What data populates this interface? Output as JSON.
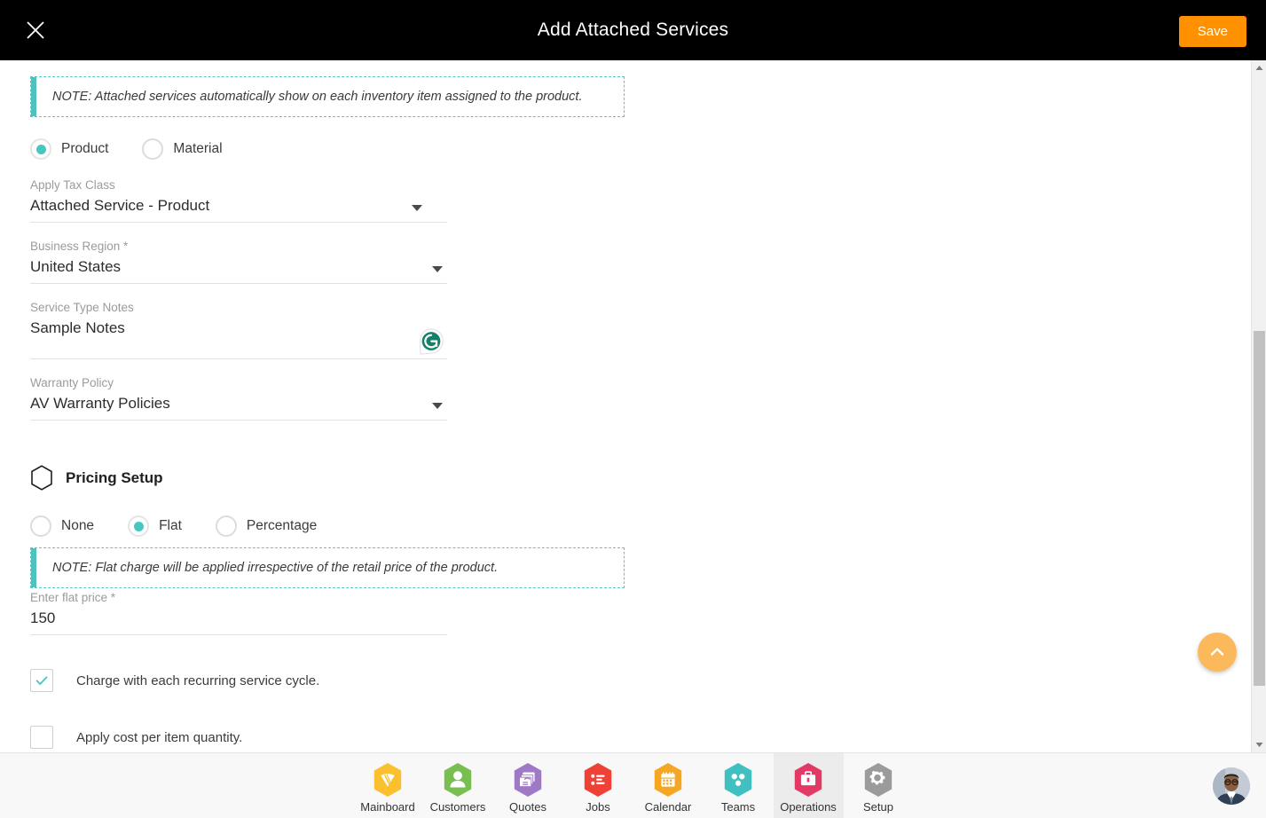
{
  "header": {
    "title": "Add Attached Services",
    "close_icon": "close-icon",
    "save_label": "Save",
    "save_color": "#ff9000",
    "background": "#000000"
  },
  "notes": {
    "top": "NOTE: Attached services automatically show on each inventory item assigned to the product.",
    "pricing": "NOTE: Flat charge will be applied irrespective of the retail price of the product.",
    "accent_color": "#4ec3bd"
  },
  "type_radios": {
    "selected": "Product",
    "options": [
      {
        "label": "Product",
        "selected": true
      },
      {
        "label": "Material",
        "selected": false
      }
    ]
  },
  "fields": {
    "tax_class": {
      "label": "Apply Tax Class",
      "value": "Attached Service - Product"
    },
    "business_region": {
      "label": "Business Region *",
      "value": "United States"
    },
    "service_type_notes": {
      "label": "Service Type Notes",
      "value": "Sample Notes",
      "addon_icon": "grammarly-icon"
    },
    "warranty_policy": {
      "label": "Warranty Policy",
      "value": "AV Warranty Policies"
    },
    "flat_price": {
      "label": "Enter flat price *",
      "value": "150"
    }
  },
  "pricing": {
    "section_title": "Pricing Setup",
    "section_icon": "hexagon-icon",
    "selected": "Flat",
    "options": [
      {
        "label": "None",
        "selected": false
      },
      {
        "label": "Flat",
        "selected": true
      },
      {
        "label": "Percentage",
        "selected": false
      }
    ]
  },
  "checkboxes": [
    {
      "label": "Charge with each recurring service cycle.",
      "checked": true
    },
    {
      "label": "Apply cost per item quantity.",
      "checked": false
    }
  ],
  "scroll_to_top": {
    "icon": "chevron-up-icon",
    "color": "#fcb95b"
  },
  "scrollbar": {
    "up_icon": "triangle-up-icon",
    "down_icon": "triangle-down-icon"
  },
  "bottom_nav": {
    "active": "Operations",
    "items": [
      {
        "label": "Mainboard",
        "icon": "mainboard-icon",
        "color": "#fbc02d",
        "active": false
      },
      {
        "label": "Customers",
        "icon": "customers-icon",
        "color": "#78be51",
        "active": false
      },
      {
        "label": "Quotes",
        "icon": "quotes-icon",
        "color": "#a079c6",
        "active": false
      },
      {
        "label": "Jobs",
        "icon": "jobs-icon",
        "color": "#ef4136",
        "active": false
      },
      {
        "label": "Calendar",
        "icon": "calendar-icon",
        "color": "#f5a623",
        "active": false
      },
      {
        "label": "Teams",
        "icon": "teams-icon",
        "color": "#40c0c0",
        "active": false
      },
      {
        "label": "Operations",
        "icon": "operations-icon",
        "color": "#e23a64",
        "active": true
      },
      {
        "label": "Setup",
        "icon": "setup-icon",
        "color": "#9b9b9b",
        "active": false
      }
    ],
    "avatar": "user-avatar"
  }
}
